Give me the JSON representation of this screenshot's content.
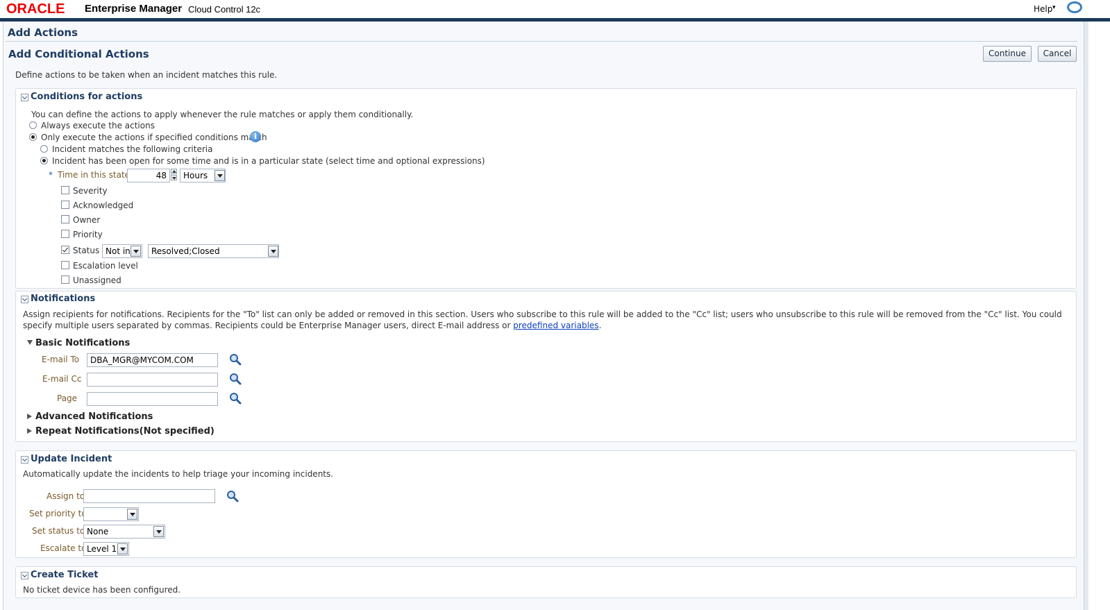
{
  "header": {
    "brand": "ORACLE",
    "product": "Enterprise Manager",
    "edition": "Cloud Control 12c",
    "help_label": "Help",
    "help_arrow": "▾"
  },
  "page": {
    "title": "Add Actions",
    "subtitle": "Add Conditional Actions",
    "continue_label": "Continue",
    "cancel_label": "Cancel",
    "description": "Define actions to be taken when an incident matches this rule."
  },
  "conditions": {
    "heading": "Conditions for actions",
    "intro": "You can define the actions to apply whenever the rule matches or apply them conditionally.",
    "always_label": "Always execute the actions",
    "only_label": "Only execute the actions if specified conditions match",
    "criteria_label": "Incident matches the following criteria",
    "open_label": "Incident has been open for some time and is in a particular state (select time and optional expressions)",
    "time_required_mark": "*",
    "time_label": "Time in this state",
    "time_value": "48",
    "time_unit": "Hours",
    "checkboxes": {
      "severity": "Severity",
      "acknowledged": "Acknowledged",
      "owner": "Owner",
      "priority": "Priority",
      "status": "Status",
      "escalation": "Escalation level",
      "unassigned": "Unassigned"
    },
    "status_operator": "Not in",
    "status_values": "Resolved;Closed"
  },
  "notifications": {
    "heading": "Notifications",
    "desc_part1": "Assign recipients for notifications. Recipients for the \"To\" list can only be added or removed in this section. Users who subscribe to this rule will be added to the \"Cc\" list; users who unsubscribe to this rule will be removed from the \"Cc\" list. You could specify multiple users separated by commas. Recipients could be Enterprise Manager users, direct E-mail address or ",
    "desc_link": "predefined variables",
    "desc_end": ".",
    "basic_heading": "Basic Notifications",
    "email_to_label": "E-mail To",
    "email_to_value": "DBA_MGR@MYCOM.COM",
    "email_cc_label": "E-mail Cc",
    "email_cc_value": "",
    "page_label": "Page",
    "page_value": "",
    "advanced_heading": "Advanced Notifications",
    "repeat_heading": "Repeat Notifications(Not specified)"
  },
  "update_incident": {
    "heading": "Update Incident",
    "desc": "Automatically update the incidents to help triage your incoming incidents.",
    "assign_label": "Assign to",
    "assign_value": "",
    "priority_label": "Set priority to",
    "priority_value": "",
    "status_label": "Set status to",
    "status_value": "None",
    "escalate_label": "Escalate to",
    "escalate_value": "Level 1"
  },
  "create_ticket": {
    "heading": "Create Ticket",
    "desc": "No ticket device has been configured."
  },
  "icons": {
    "info": "info-icon",
    "search": "search-icon",
    "dropdown": "chevron-down-icon",
    "collapse": "collapse-icon",
    "expand": "expand-icon"
  },
  "colors": {
    "brand_red": "#e00000",
    "header_bar": "#1a3a5c",
    "heading_blue": "#1f3d63",
    "link_blue": "#0b3fbf",
    "field_label": "#7a5a2a"
  }
}
